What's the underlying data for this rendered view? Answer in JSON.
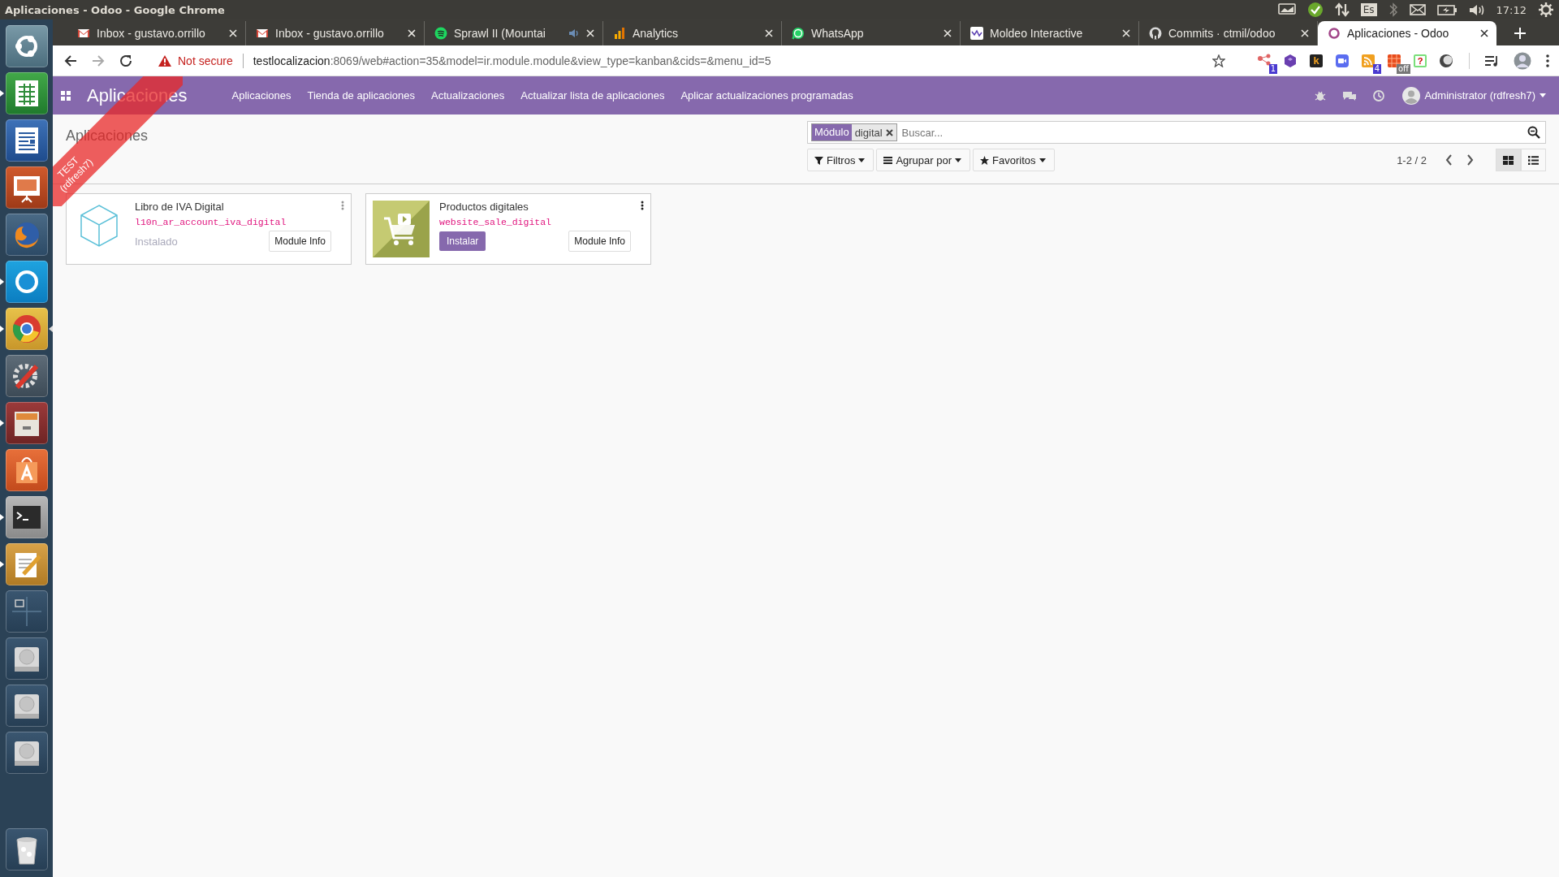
{
  "system_bar": {
    "window_title": "Aplicaciones - Odoo - Google Chrome",
    "indicators": [
      {
        "kind": "display"
      },
      {
        "kind": "check"
      },
      {
        "kind": "network"
      },
      {
        "kind": "keyboard",
        "text": "Es"
      },
      {
        "kind": "bluetooth"
      },
      {
        "kind": "mail"
      },
      {
        "kind": "battery"
      },
      {
        "kind": "volume"
      },
      {
        "kind": "clock",
        "text": "17:12"
      },
      {
        "kind": "gear"
      }
    ]
  },
  "launcher": {
    "items": [
      {
        "kind": "ubuntu",
        "running": false
      },
      {
        "kind": "spreadsheet",
        "running": true
      },
      {
        "kind": "document",
        "running": false
      },
      {
        "kind": "presentation",
        "running": false
      },
      {
        "kind": "firefox",
        "running": false
      },
      {
        "kind": "skype",
        "running": true
      },
      {
        "kind": "chrome",
        "running": true,
        "focused": true
      },
      {
        "kind": "settings",
        "running": false
      },
      {
        "kind": "files",
        "running": true
      },
      {
        "kind": "store",
        "running": false
      },
      {
        "kind": "terminal",
        "running": true
      },
      {
        "kind": "editor",
        "running": true
      },
      {
        "kind": "workspaces",
        "running": false
      },
      {
        "kind": "drive",
        "running": false
      },
      {
        "kind": "drive",
        "running": false
      },
      {
        "kind": "drive",
        "running": false
      }
    ],
    "trash": {
      "kind": "trash"
    }
  },
  "tabs": [
    {
      "title": "Inbox - gustavo.orrillo",
      "kind": "mail",
      "selected": false,
      "audio": false
    },
    {
      "title": "Inbox - gustavo.orrillo",
      "kind": "mail",
      "selected": false,
      "audio": false
    },
    {
      "title": "Sprawl II (Mountai",
      "kind": "music",
      "selected": false,
      "audio": true
    },
    {
      "title": "Analytics",
      "kind": "bars",
      "selected": false,
      "audio": false
    },
    {
      "title": "WhatsApp",
      "kind": "chat",
      "selected": false,
      "audio": false
    },
    {
      "title": "Moldeo Interactive",
      "kind": "wave",
      "selected": false,
      "audio": false
    },
    {
      "title": "Commits · ctmil/odoo",
      "kind": "octo",
      "selected": false,
      "audio": false
    },
    {
      "title": "Aplicaciones - Odoo",
      "kind": "ring",
      "selected": true,
      "audio": false
    }
  ],
  "address_bar": {
    "security": "Not secure",
    "host": "testlocalizacion",
    "path": ":8069/web#action=35&model=ir.module.module&view_type=kanban&cids=&menu_id=5"
  },
  "extensions": [
    {
      "kind": "share",
      "badge": "1"
    },
    {
      "kind": "cube"
    },
    {
      "kind": "letter",
      "label": "k"
    },
    {
      "kind": "camera"
    },
    {
      "kind": "feed",
      "badge": "4"
    },
    {
      "kind": "grid",
      "badge": "off"
    },
    {
      "kind": "help",
      "label": "?"
    },
    {
      "kind": "moon"
    }
  ],
  "navbar": {
    "brand": "Aplicaciones",
    "menu": [
      "Aplicaciones",
      "Tienda de aplicaciones",
      "Actualizaciones",
      "Actualizar lista de aplicaciones",
      "Aplicar actualizaciones programadas"
    ],
    "user": "Administrator (rdfresh7)"
  },
  "ribbon": [
    "TEST",
    "(rdfresh7)"
  ],
  "control_panel": {
    "breadcrumb": "Aplicaciones",
    "search": {
      "facet_label": "Módulo",
      "facet_value": "digital",
      "placeholder": "Buscar..."
    },
    "buttons": [
      {
        "label": "Filtros",
        "kind": "filter"
      },
      {
        "label": "Agrupar por",
        "kind": "bars"
      },
      {
        "label": "Favoritos",
        "kind": "star"
      }
    ],
    "pager": "1-2 / 2",
    "views": [
      {
        "kind": "kanban",
        "selected": true
      },
      {
        "kind": "list",
        "selected": false
      }
    ]
  },
  "modules": [
    {
      "name": "Libro de IVA Digital",
      "technical_name": "l10n_ar_account_iva_digital",
      "kind": "cube",
      "installed": true,
      "status": "Instalado",
      "info_button": "Module Info"
    },
    {
      "name": "Productos digitales",
      "technical_name": "website_sale_digital",
      "kind": "cart",
      "installed": false,
      "status": "Instalar",
      "info_button": "Module Info"
    }
  ]
}
